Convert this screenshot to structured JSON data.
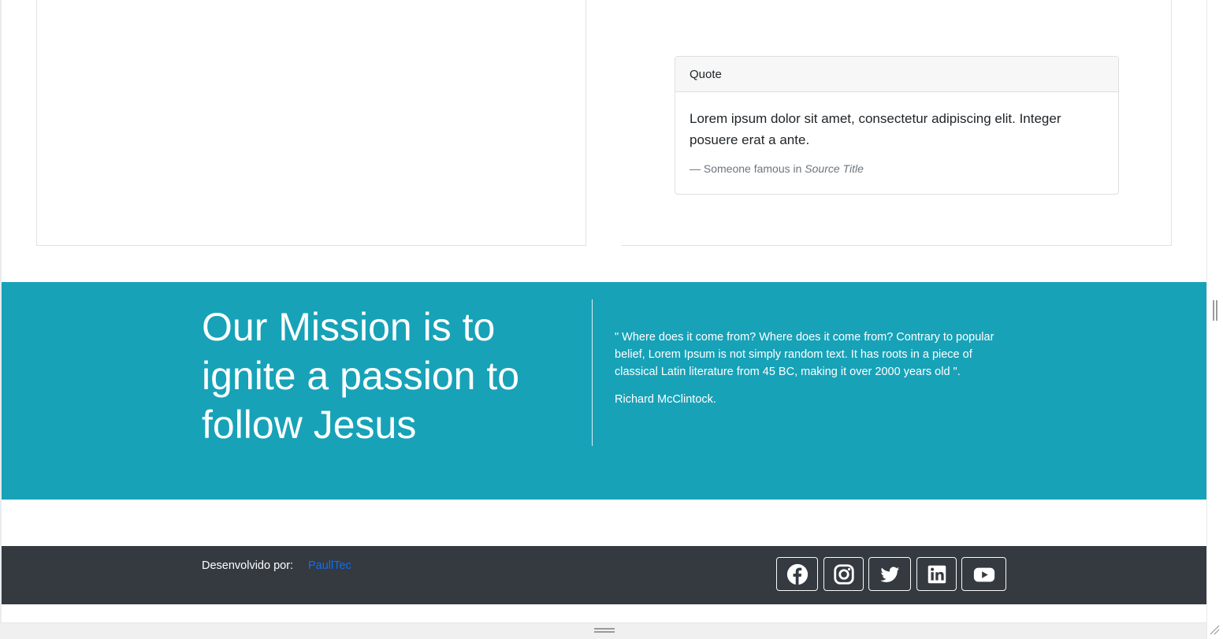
{
  "quote_card": {
    "header": "Quote",
    "text": "Lorem ipsum dolor sit amet, consectetur adipiscing elit. Integer posuere erat a ante.",
    "footer_prefix": "— Someone famous in ",
    "footer_source": "Source Title"
  },
  "mission": {
    "title": "Our Mission is to ignite a passion to follow Jesus",
    "quote": "\" Where does it come from? Where does it come from? Contrary to popular belief, Lorem Ipsum is not simply random text. It has roots in a piece of classical Latin literature from 45 BC, making it over 2000 years old \".",
    "author": "Richard McClintock.",
    "background_color": "#17a2b8"
  },
  "footer": {
    "developed_by_label": "Desenvolvido por:",
    "developer_link": "PaullTec",
    "background_color": "#343a40",
    "social": [
      {
        "name": "facebook-icon"
      },
      {
        "name": "instagram-icon"
      },
      {
        "name": "twitter-icon"
      },
      {
        "name": "linkedin-icon"
      },
      {
        "name": "youtube-icon"
      }
    ]
  }
}
